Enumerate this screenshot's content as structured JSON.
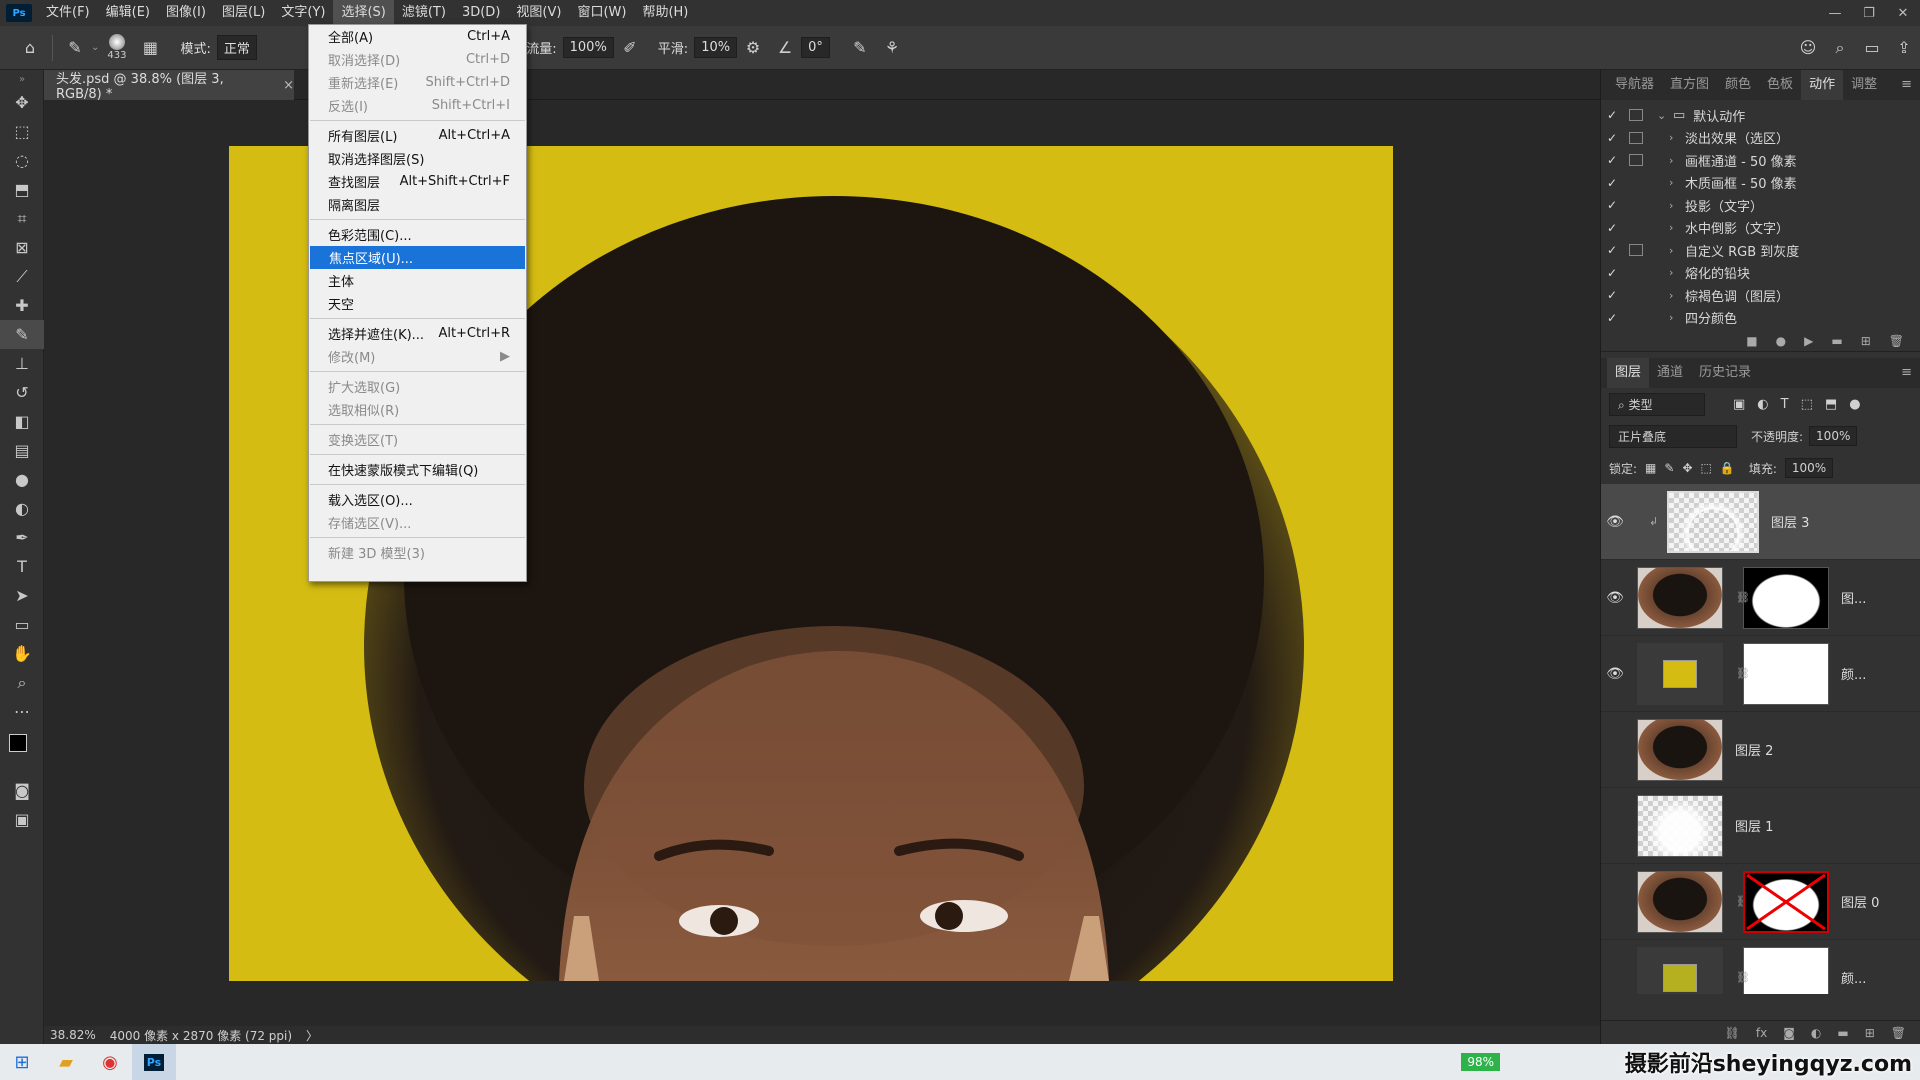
{
  "menubar": {
    "logo": "Ps",
    "items": [
      "文件(F)",
      "编辑(E)",
      "图像(I)",
      "图层(L)",
      "文字(Y)",
      "选择(S)",
      "滤镜(T)",
      "3D(D)",
      "视图(V)",
      "窗口(W)",
      "帮助(H)"
    ]
  },
  "window_controls": [
    "—",
    "❐",
    "✕"
  ],
  "options": {
    "brush_size": "433",
    "mode_label": "模式:",
    "mode_value": "正常",
    "flow_label": "流量:",
    "flow_value": "100%",
    "smooth_label": "平滑:",
    "smooth_value": "10%",
    "angle_value": "0°"
  },
  "document": {
    "tab_title": "头发.psd @ 38.8% (图层 3, RGB/8) *",
    "close": "×",
    "zoom": "38.82%",
    "info": "4000 像素 x 2870 像素 (72 ppi)",
    "arrow": "〉",
    "background_color": "#d4bc12"
  },
  "select_menu": {
    "items": [
      {
        "label": "全部(A)",
        "shortcut": "Ctrl+A",
        "state": "normal"
      },
      {
        "label": "取消选择(D)",
        "shortcut": "Ctrl+D",
        "state": "disabled"
      },
      {
        "label": "重新选择(E)",
        "shortcut": "Shift+Ctrl+D",
        "state": "disabled"
      },
      {
        "label": "反选(I)",
        "shortcut": "Shift+Ctrl+I",
        "state": "disabled"
      },
      {
        "sep": true
      },
      {
        "label": "所有图层(L)",
        "shortcut": "Alt+Ctrl+A",
        "state": "normal"
      },
      {
        "label": "取消选择图层(S)",
        "shortcut": "",
        "state": "normal"
      },
      {
        "label": "查找图层",
        "shortcut": "Alt+Shift+Ctrl+F",
        "state": "normal"
      },
      {
        "label": "隔离图层",
        "shortcut": "",
        "state": "normal"
      },
      {
        "sep": true
      },
      {
        "label": "色彩范围(C)...",
        "shortcut": "",
        "state": "normal"
      },
      {
        "label": "焦点区域(U)...",
        "shortcut": "",
        "state": "highlighted"
      },
      {
        "label": "主体",
        "shortcut": "",
        "state": "normal"
      },
      {
        "label": "天空",
        "shortcut": "",
        "state": "normal"
      },
      {
        "sep": true
      },
      {
        "label": "选择并遮住(K)...",
        "shortcut": "Alt+Ctrl+R",
        "state": "normal"
      },
      {
        "label": "修改(M)",
        "shortcut": "▶",
        "state": "disabled"
      },
      {
        "sep": true
      },
      {
        "label": "扩大选取(G)",
        "shortcut": "",
        "state": "disabled"
      },
      {
        "label": "选取相似(R)",
        "shortcut": "",
        "state": "disabled"
      },
      {
        "sep": true
      },
      {
        "label": "变换选区(T)",
        "shortcut": "",
        "state": "disabled"
      },
      {
        "sep": true
      },
      {
        "label": "在快速蒙版模式下编辑(Q)",
        "shortcut": "",
        "state": "normal"
      },
      {
        "sep": true
      },
      {
        "label": "载入选区(O)...",
        "shortcut": "",
        "state": "normal"
      },
      {
        "label": "存储选区(V)...",
        "shortcut": "",
        "state": "disabled"
      },
      {
        "sep": true
      },
      {
        "label": "新建 3D 模型(3)",
        "shortcut": "",
        "state": "disabled"
      }
    ]
  },
  "actions_panel": {
    "tabs": [
      "导航器",
      "直方图",
      "颜色",
      "色板",
      "动作",
      "调整"
    ],
    "active_tab": "动作",
    "items": [
      {
        "name": "默认动作",
        "box": true,
        "folder": true
      },
      {
        "name": "淡出效果（选区）",
        "box": true
      },
      {
        "name": "画框通道 - 50 像素",
        "box": true
      },
      {
        "name": "木质画框 - 50 像素",
        "box": false
      },
      {
        "name": "投影（文字）",
        "box": false
      },
      {
        "name": "水中倒影（文字）",
        "box": false
      },
      {
        "name": "自定义 RGB 到灰度",
        "box": true
      },
      {
        "name": "熔化的铅块",
        "box": false
      },
      {
        "name": "棕褐色调（图层）",
        "box": false
      },
      {
        "name": "四分颜色",
        "box": false
      }
    ]
  },
  "layers_panel": {
    "tabs": [
      "图层",
      "通道",
      "历史记录"
    ],
    "filter_label": "类型",
    "blend_mode": "正片叠底",
    "opacity_label": "不透明度:",
    "opacity_value": "100%",
    "lock_label": "锁定:",
    "fill_label": "填充:",
    "fill_value": "100%",
    "layers": [
      {
        "name": "图层 3",
        "visible": true
      },
      {
        "name": "图...",
        "visible": true
      },
      {
        "name": "颜...",
        "visible": true
      },
      {
        "name": "图层 2",
        "visible": false
      },
      {
        "name": "图层 1",
        "visible": false
      },
      {
        "name": "图层 0",
        "visible": false
      },
      {
        "name": "颜...",
        "visible": false
      }
    ]
  },
  "taskbar": {
    "battery": "98%",
    "watermark": "摄影前沿sheyingqyz.com"
  }
}
